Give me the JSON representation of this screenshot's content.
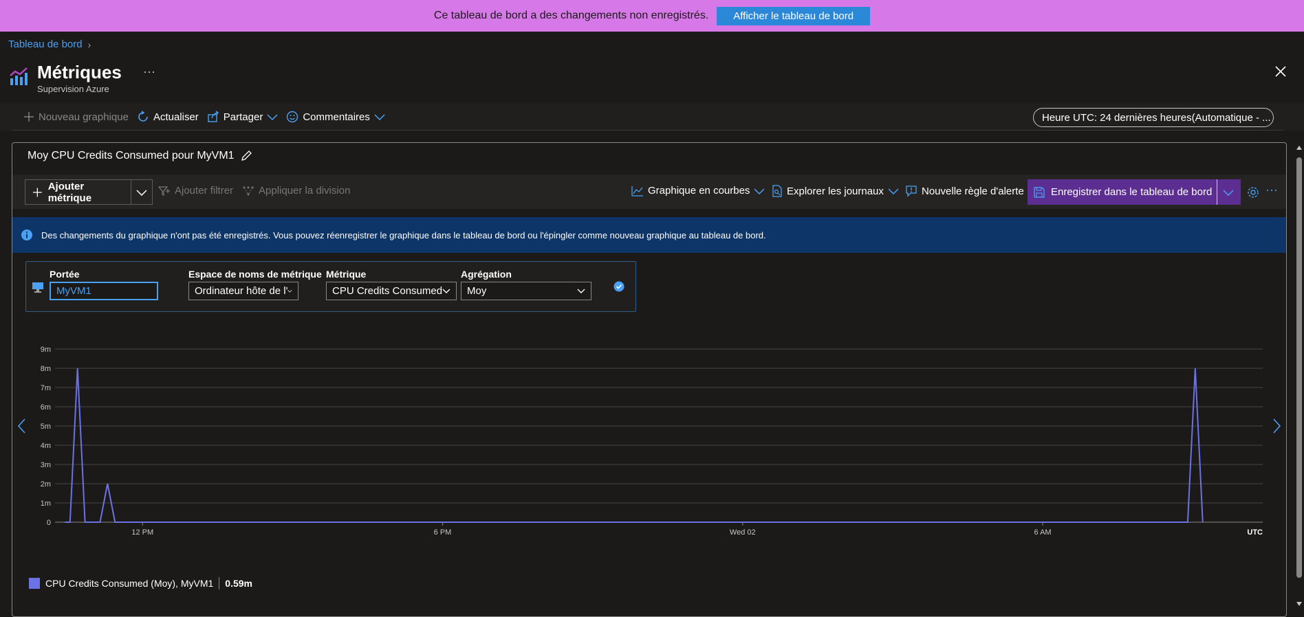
{
  "banner": {
    "message": "Ce tableau de bord a des changements non enregistrés.",
    "button_label": "Afficher le tableau de bord"
  },
  "breadcrumb": {
    "label": "Tableau de bord"
  },
  "header": {
    "title": "Métriques",
    "subtitle": "Supervision Azure",
    "ellipsis": "···"
  },
  "toolbar": {
    "new_chart": "Nouveau graphique",
    "refresh": "Actualiser",
    "share": "Partager",
    "feedback": "Commentaires",
    "time_range": "Heure UTC: 24 dernières heures(Automatique - ..."
  },
  "chart_panel": {
    "title": "Moy CPU Credits Consumed pour MyVM1",
    "add_metric": "Ajouter métrique",
    "add_filter": "Ajouter filtrer",
    "apply_split": "Appliquer la division",
    "chart_type": "Graphique en courbes",
    "explore_logs": "Explorer les journaux",
    "new_alert": "Nouvelle règle d'alerte",
    "save_to_dashboard": "Enregistrer dans le tableau de bord",
    "more": "···",
    "info_message": "Des changements du graphique n'ont pas été enregistrés. Vous pouvez réenregistrer le graphique dans le tableau de bord ou l'épingler comme nouveau graphique au tableau de bord."
  },
  "metric_row": {
    "scope_label": "Portée",
    "scope_value": "MyVM1",
    "namespace_label": "Espace de noms de métrique",
    "namespace_value": "Ordinateur hôte de l'",
    "metric_label": "Métrique",
    "metric_value": "CPU Credits Consumed",
    "aggregation_label": "Agrégation",
    "aggregation_value": "Moy"
  },
  "legend": {
    "label": "CPU Credits Consumed (Moy), MyVM1",
    "value": "0.59m"
  },
  "colors": {
    "banner": "#d678e8",
    "accent": "#4aa0f2",
    "series": "#6a73e6",
    "save_button": "#5c2e91",
    "info_bar": "#0d3568"
  },
  "chart_data": {
    "type": "line",
    "x_tick_labels": [
      "12 PM",
      "6 PM",
      "Wed 02",
      "6 AM"
    ],
    "x_unit_label": "UTC",
    "y_tick_labels": [
      "0",
      "1m",
      "2m",
      "3m",
      "4m",
      "5m",
      "6m",
      "7m",
      "8m",
      "9m"
    ],
    "ylim": [
      0,
      9
    ],
    "y_unit": "m",
    "xlim_hours": [
      -1.75,
      22.4
    ],
    "x_axis_note": "hours relative to 12 PM",
    "grid": true,
    "series": [
      {
        "name": "CPU Credits Consumed (Moy), MyVM1",
        "x": [
          -1.55,
          -1.45,
          -1.3,
          -1.15,
          -0.85,
          -0.7,
          -0.55,
          -0.45,
          20.7,
          20.9,
          21.05,
          21.2
        ],
        "y": [
          0,
          0,
          8,
          0,
          0,
          2,
          0,
          0,
          0,
          0,
          8,
          0
        ]
      }
    ],
    "dotted_baseline_x": [
      -0.3,
      20.6
    ]
  }
}
